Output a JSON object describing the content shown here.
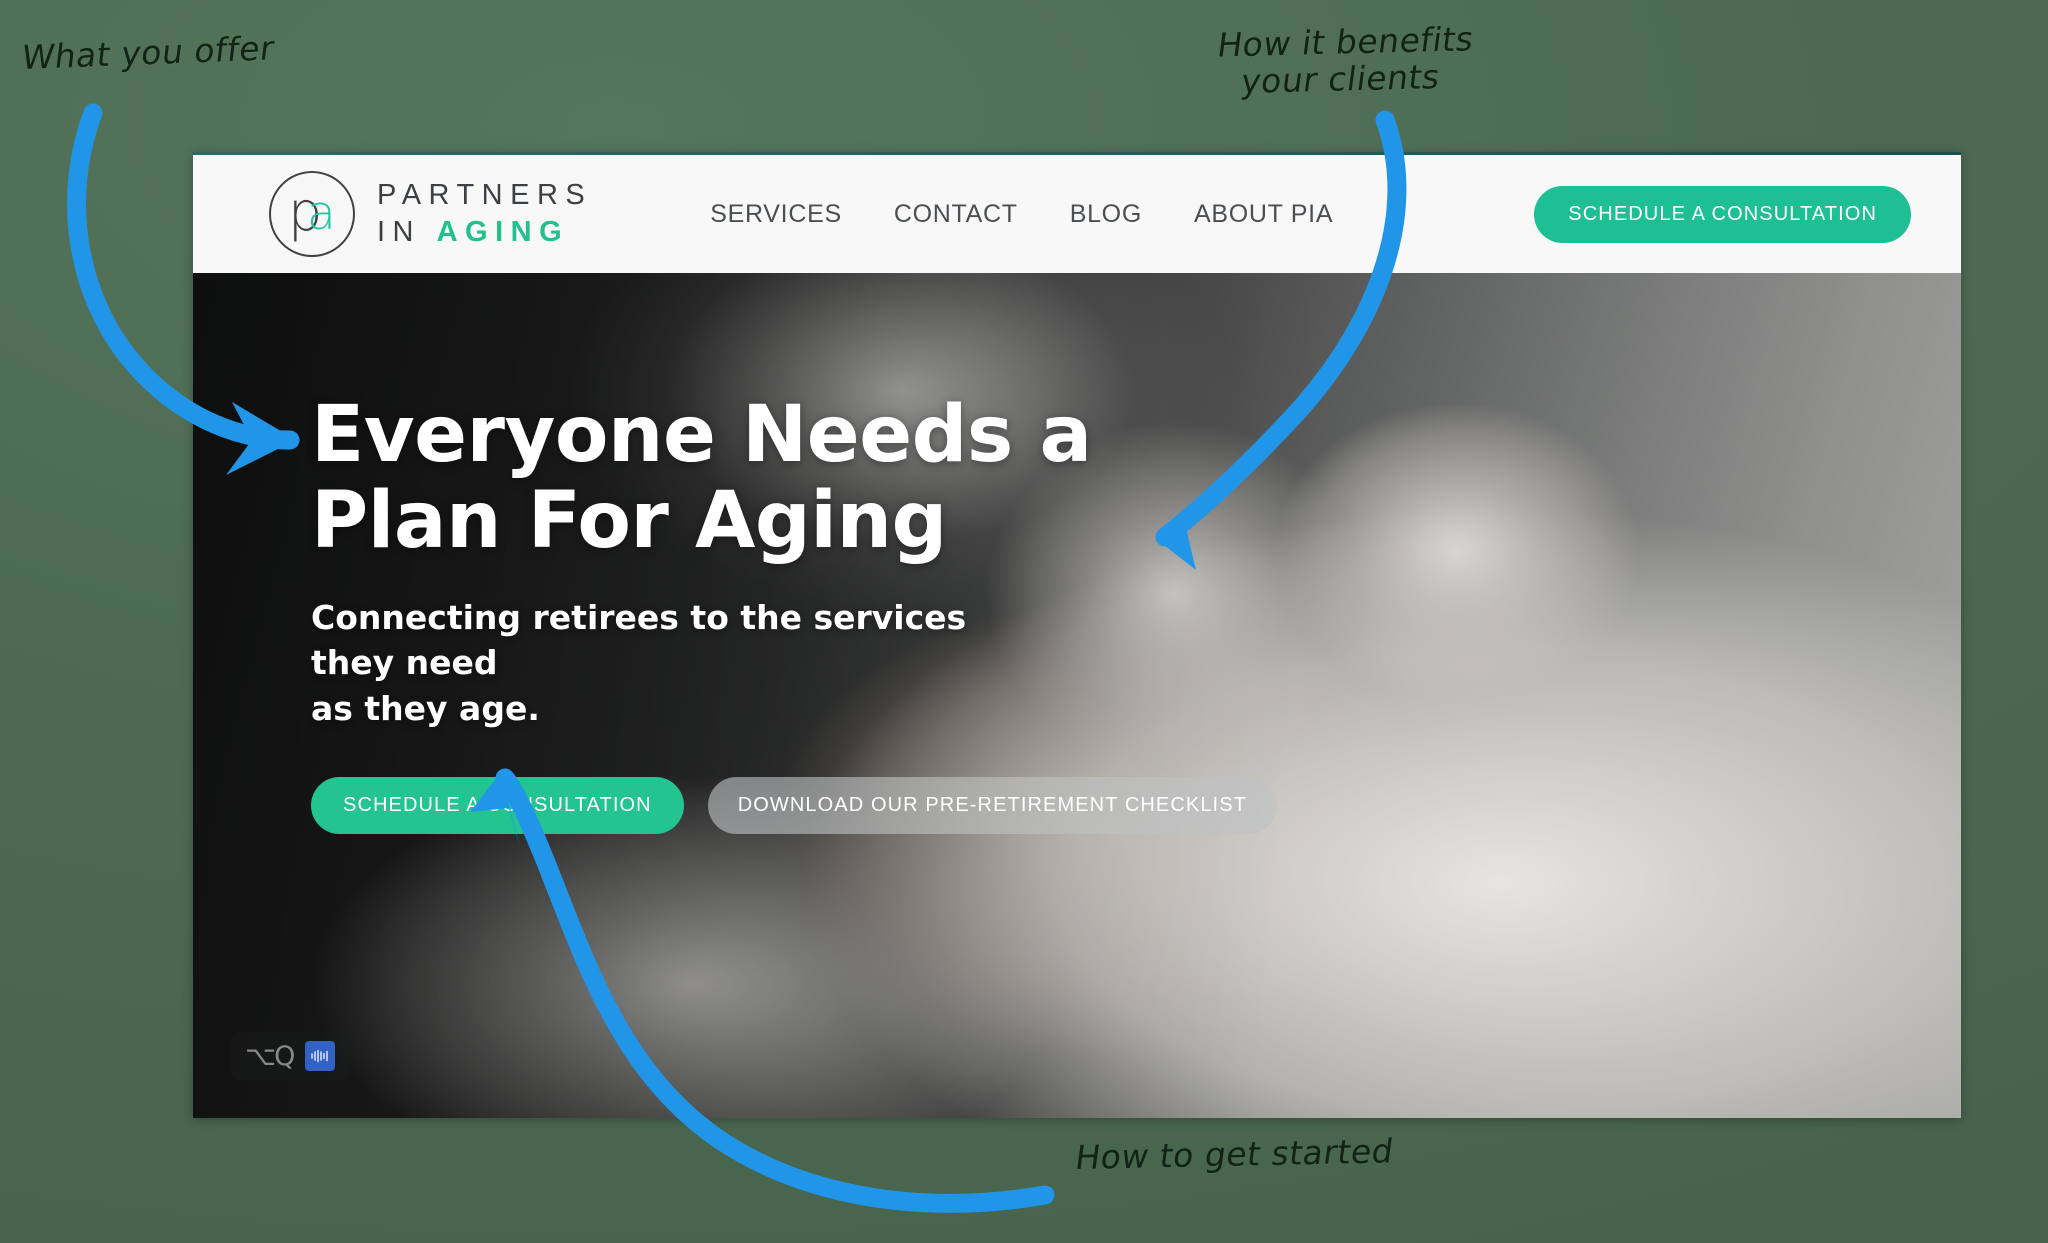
{
  "annotations": {
    "top_left": "What you offer",
    "top_right": "How it benefits\nyour clients",
    "bottom": "How to get started",
    "arrow_color": "#2196e8",
    "background_color": "#4d6b54"
  },
  "site": {
    "header": {
      "logo": {
        "mark_letters": "pa",
        "mark_p": "p",
        "mark_a": "a",
        "line1": "PARTNERS",
        "line2_prefix": "IN ",
        "line2_accent": "AGING",
        "accent_color": "#23c08f"
      },
      "nav": [
        {
          "label": "SERVICES"
        },
        {
          "label": "CONTACT"
        },
        {
          "label": "BLOG"
        },
        {
          "label": "ABOUT PIA"
        }
      ],
      "cta_label": "SCHEDULE A CONSULTATION",
      "cta_color": "#1fbf96"
    },
    "hero": {
      "title": "Everyone Needs a\nPlan For Aging",
      "subtitle": "Connecting retirees to the services they need\nas they age.",
      "primary_button": "SCHEDULE A CONSULTATION",
      "secondary_button": "DOWNLOAD OUR PRE-RETIREMENT CHECKLIST",
      "primary_button_color": "#23c48f",
      "widget": {
        "glyph": "⌥Q",
        "badge_icon": "waveform-icon"
      }
    }
  }
}
